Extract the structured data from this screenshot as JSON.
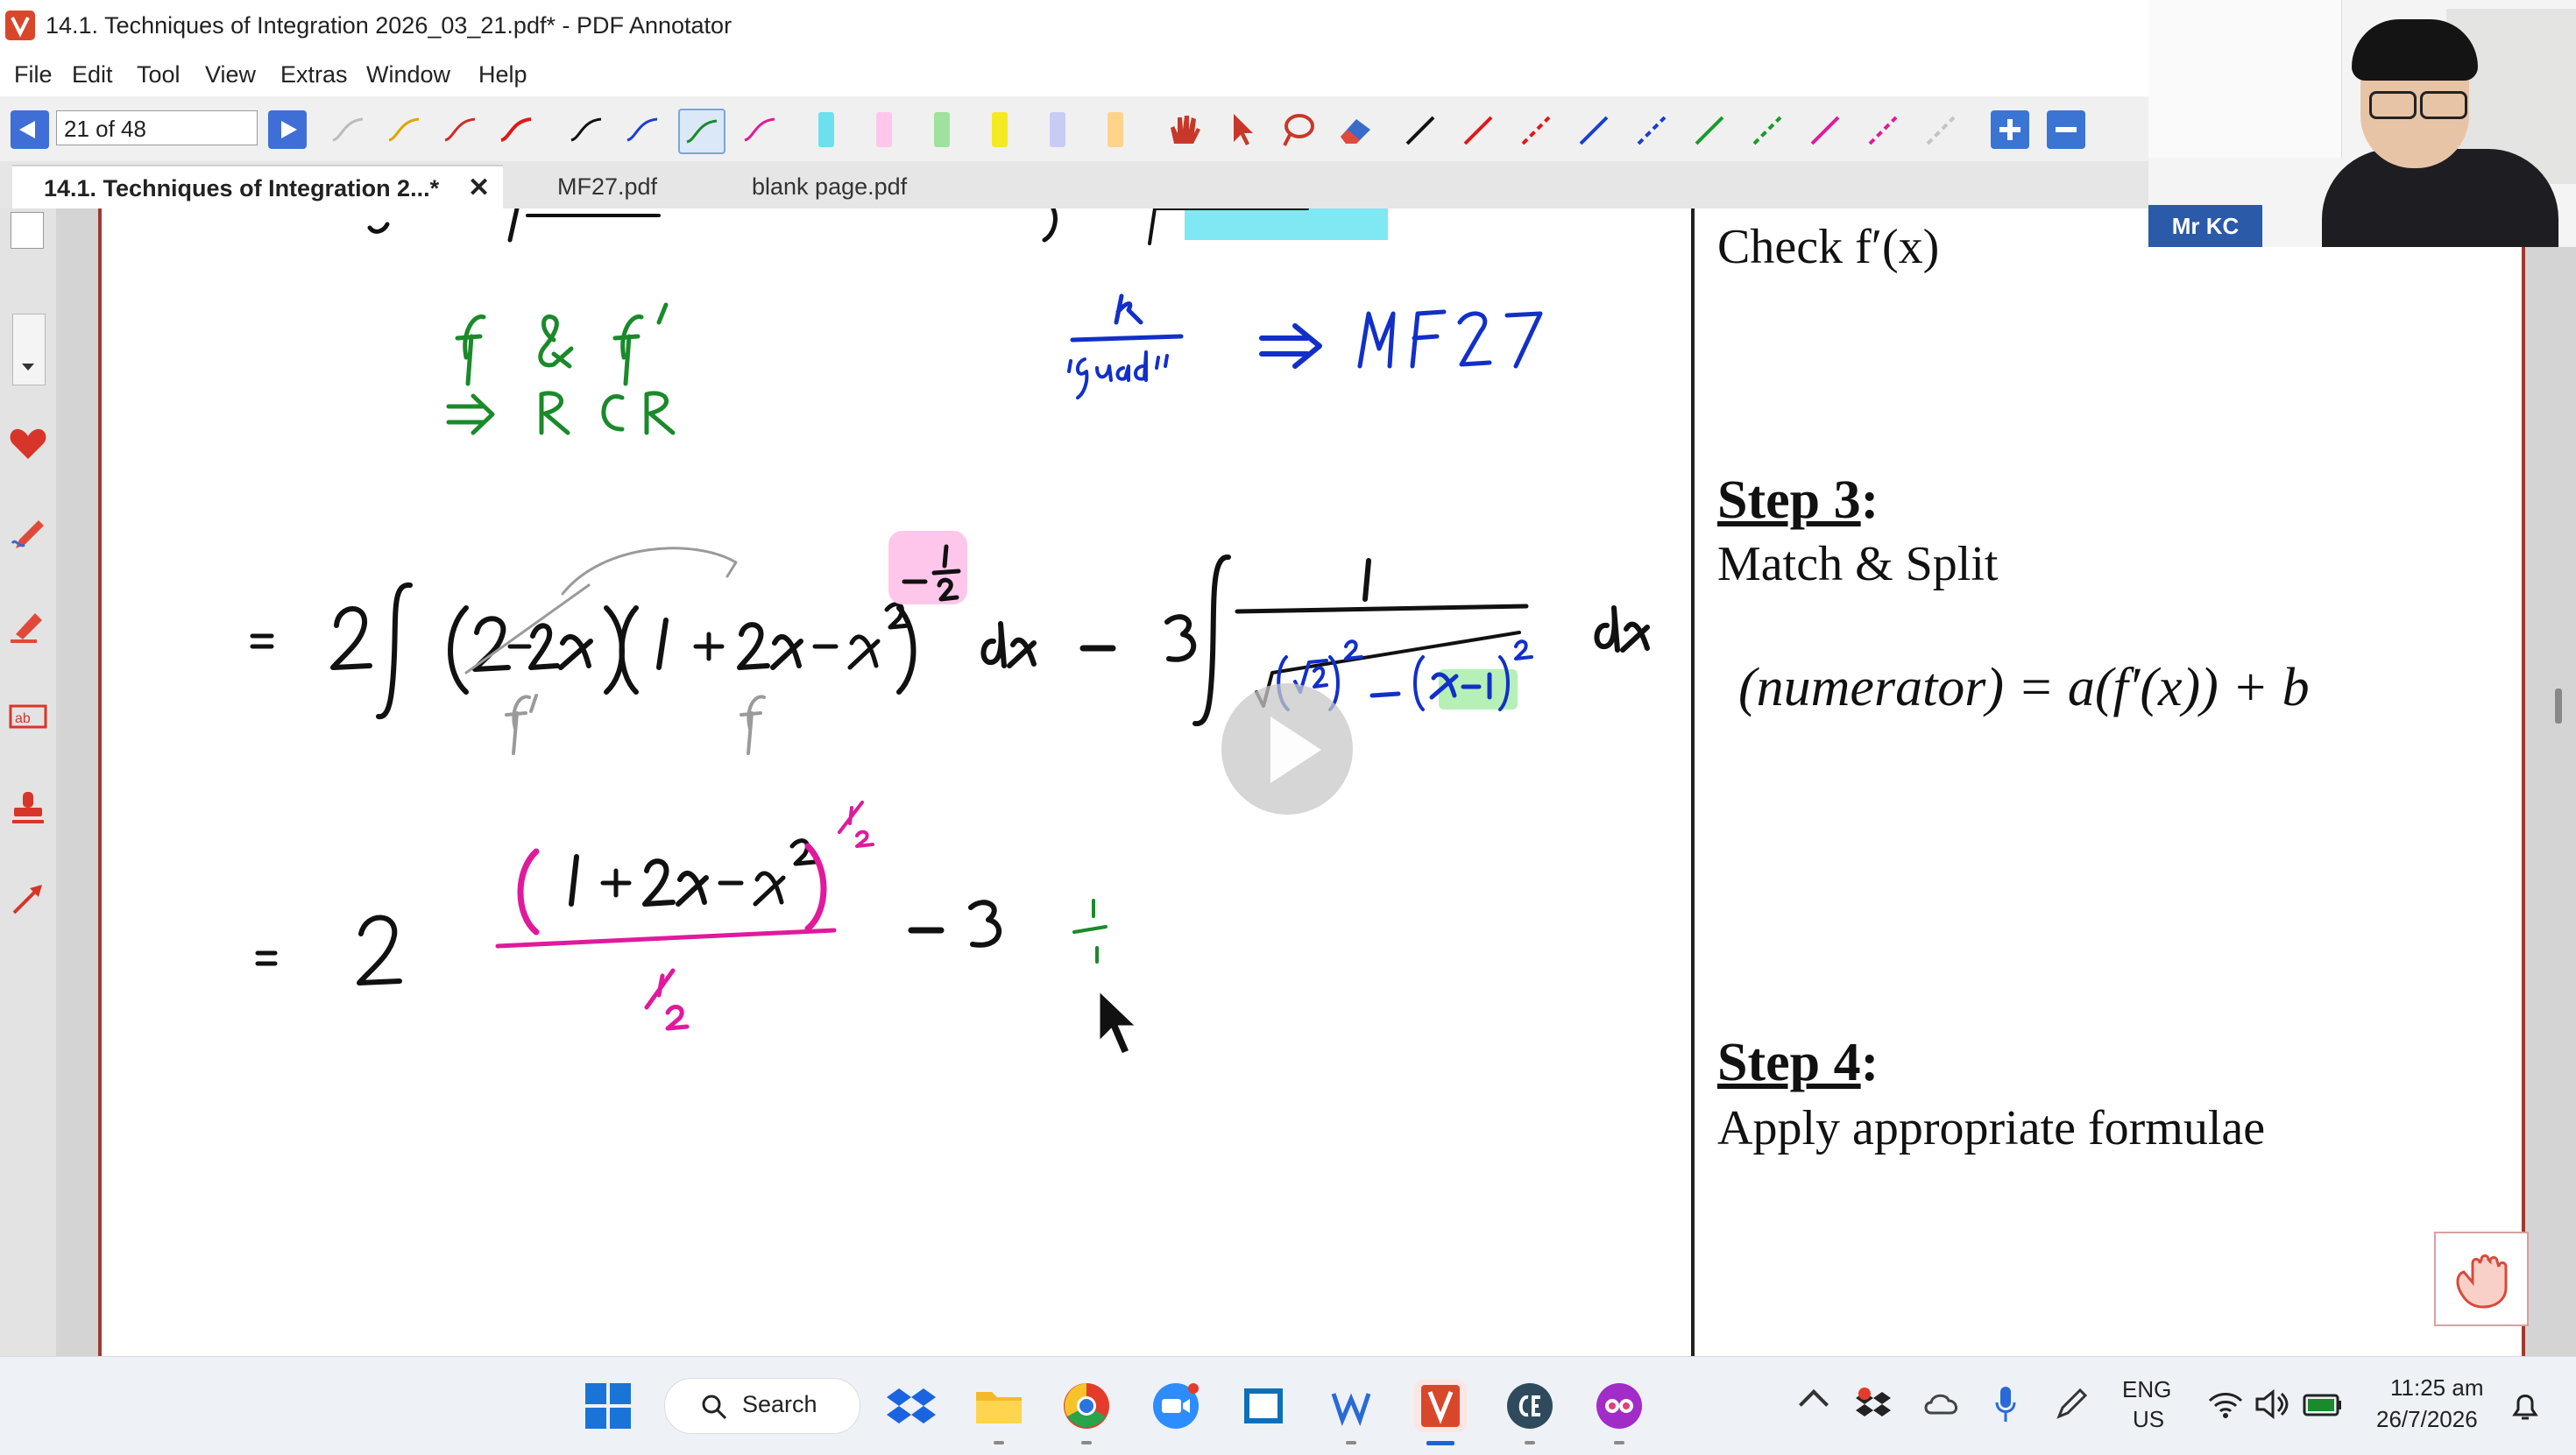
{
  "window": {
    "title": "14.1. Techniques of Integration 2026_03_21.pdf* - PDF Annotator"
  },
  "menu": {
    "items": [
      "File",
      "Edit",
      "Tool",
      "View",
      "Extras",
      "Window",
      "Help"
    ]
  },
  "toolbar": {
    "page_indicator": "21 of 48"
  },
  "tabs": [
    {
      "label": "14.1. Techniques of Integration 2...*"
    },
    {
      "label": "MF27.pdf"
    },
    {
      "label": "blank page.pdf"
    }
  ],
  "tab_close": "✕",
  "notes": {
    "check": "Check f′(x)",
    "step3_label": "Step 3",
    "step3_colon": ":",
    "step3_text": "Match & Split",
    "formula": "(numerator) = a(f′(x)) + b",
    "step4_label": "Step 4",
    "step4_colon": ":",
    "step4_text": "Apply appropriate formulae"
  },
  "webcam": {
    "name": "Mr KC"
  },
  "taskbar": {
    "search_label": "Search",
    "lang_1": "ENG",
    "lang_2": "US",
    "time": "11:25 am",
    "date": "26/7/2026"
  },
  "colors": {
    "ink_black": "#111111",
    "ink_green": "#1a8a2a",
    "ink_blue": "#1230c8",
    "ink_magenta": "#e01a9c",
    "highlight_pink": "#ffc6ec",
    "highlight_cyan": "#7fe8f2",
    "highlight_green": "#b6f0b6",
    "app_red": "#d9472b",
    "accent_blue": "#3f6fd6"
  }
}
